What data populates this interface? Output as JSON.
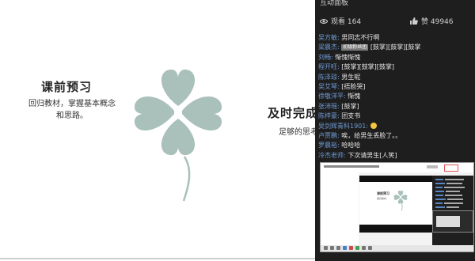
{
  "slide": {
    "left_title": "课前预习",
    "left_desc": "回归教材，掌握基本概念和思路。",
    "right_title": "及时完成",
    "right_desc": "足够的思考",
    "clover_color": "#a9c0bb"
  },
  "panel": {
    "header": "互动面板",
    "views_label": "观看 164",
    "likes_label": "赞 49946",
    "username_color": "#6f9bd6",
    "chat": [
      {
        "user": "吴方敏",
        "text": "男同志不行啊"
      },
      {
        "user": "梁晨杰",
        "badge": "初级粉丝团",
        "text": "[鼓掌][鼓掌][鼓掌"
      },
      {
        "user": "刘畅",
        "text": "惭愧惭愧"
      },
      {
        "user": "程开旺",
        "text": "[鼓掌][鼓掌][鼓掌]"
      },
      {
        "user": "陈泽琼",
        "text": "男生呢"
      },
      {
        "user": "吴艾琴",
        "text": "[捂脸哭]"
      },
      {
        "user": "徐敬洋平",
        "text": "惭愧"
      },
      {
        "user": "张沛瑶",
        "text": "[鼓掌]"
      },
      {
        "user": "陈梓豪",
        "text": "团支书"
      },
      {
        "user": "吴剑辉青科1901",
        "text": "",
        "smile": true
      },
      {
        "user": "卢贾鹏",
        "text": "唉，给男生丢脸了。。"
      },
      {
        "user": "罗晨裕",
        "text": "哈哈哈"
      },
      {
        "user": "冷杰老师",
        "text": "下次请男生[人笑]"
      }
    ]
  },
  "thumbnail": {
    "mini_title": "课前预习",
    "mini_sub": "回归教材"
  }
}
